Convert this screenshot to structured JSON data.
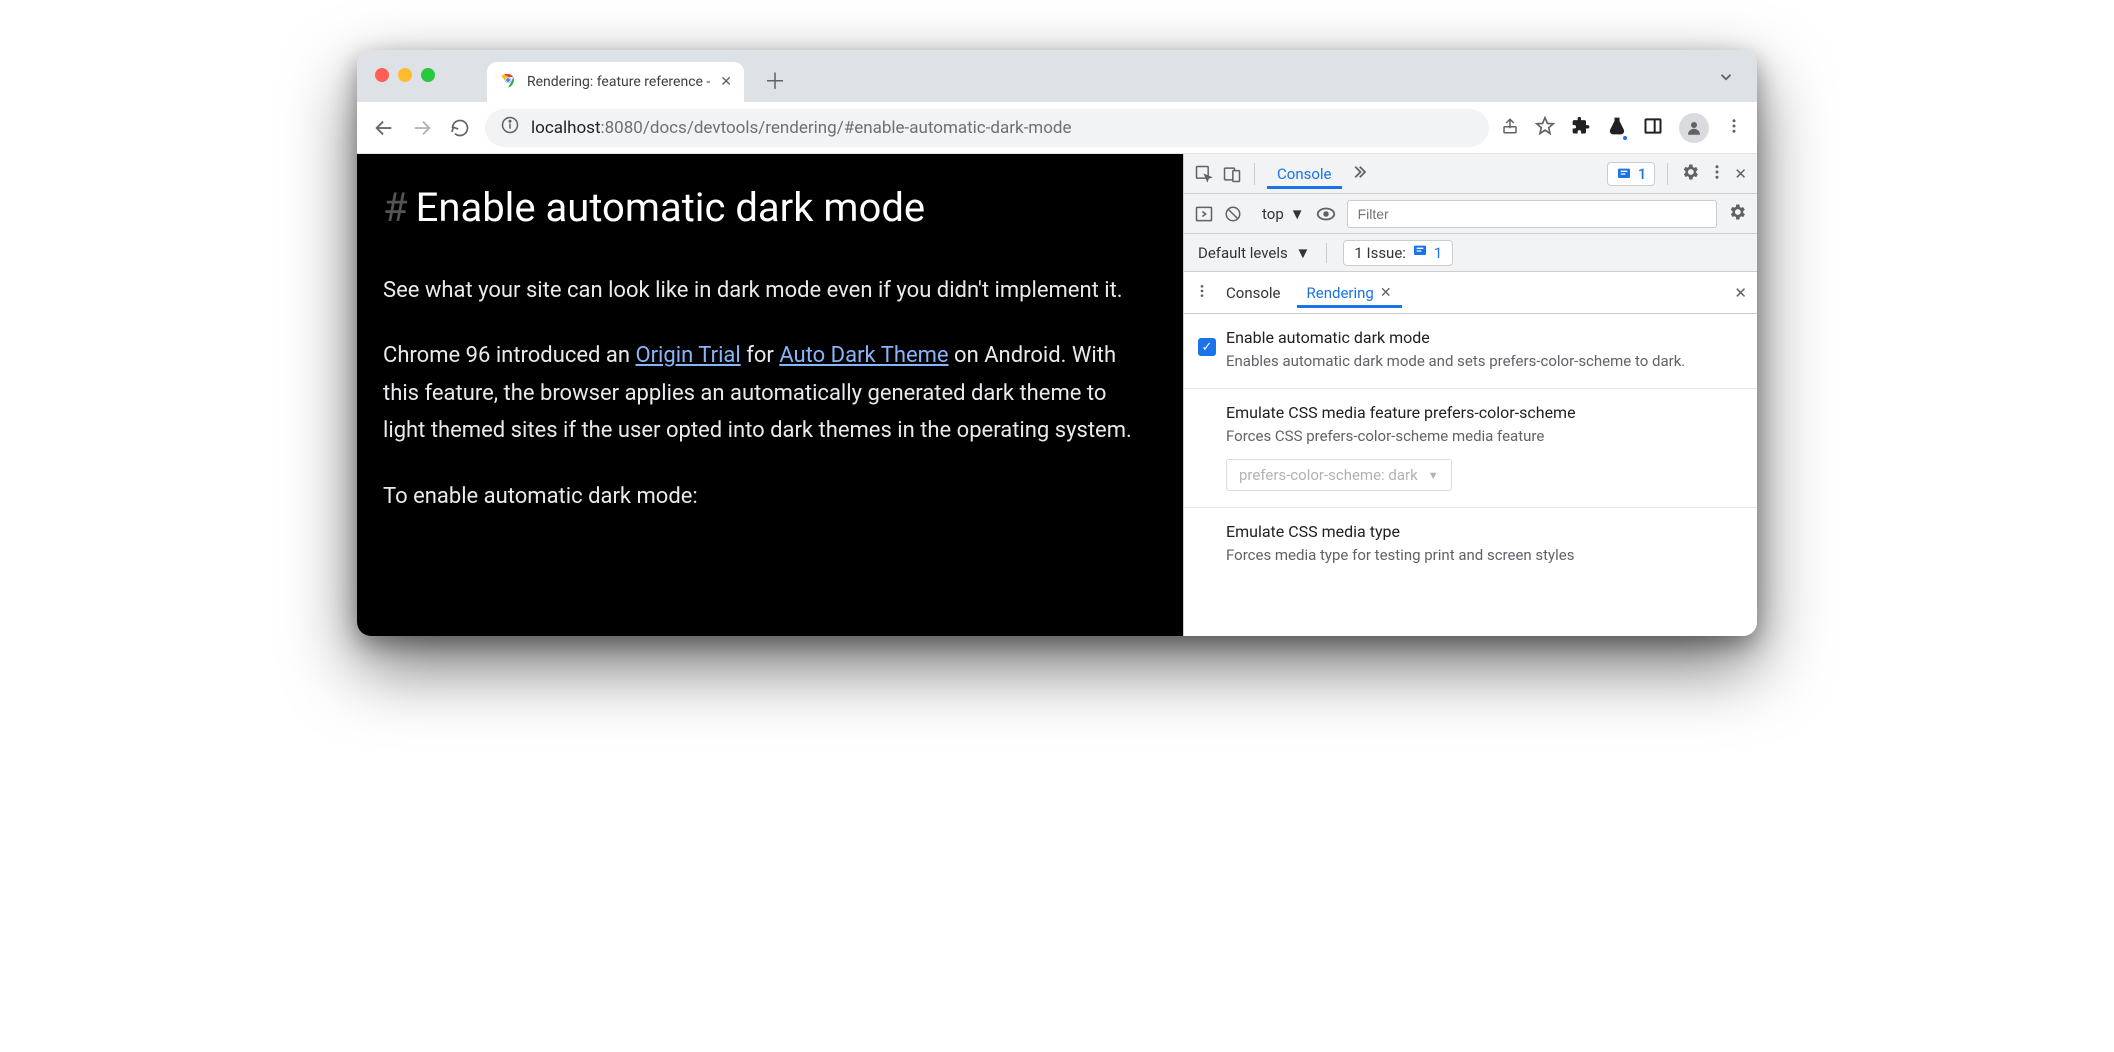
{
  "tab": {
    "title": "Rendering: feature reference -"
  },
  "omnibox": {
    "domain": "localhost",
    "port": ":8080",
    "path": "/docs/devtools/rendering/#enable-automatic-dark-mode"
  },
  "page": {
    "heading": "Enable automatic dark mode",
    "p1": "See what your site can look like in dark mode even if you didn't implement it.",
    "p2_a": "Chrome 96 introduced an ",
    "link1": "Origin Trial",
    "p2_b": " for ",
    "link2": "Auto Dark Theme",
    "p2_c": " on Android. With this feature, the browser applies an automatically generated dark theme to light themed sites if the user opted into dark themes in the operating system.",
    "p3": "To enable automatic dark mode:"
  },
  "devtools": {
    "topTabs": {
      "console": "Console"
    },
    "issuesBadge": "1",
    "consoleToolbar": {
      "context": "top",
      "filterPlaceholder": "Filter"
    },
    "levelsRow": {
      "levels": "Default levels",
      "issuesLabel": "1 Issue:",
      "issuesCount": "1"
    },
    "drawerTabs": {
      "console": "Console",
      "rendering": "Rendering"
    },
    "options": {
      "enableDark": {
        "title": "Enable automatic dark mode",
        "desc": "Enables automatic dark mode and sets prefers-color-scheme to dark."
      },
      "prefersScheme": {
        "title": "Emulate CSS media feature prefers-color-scheme",
        "desc": "Forces CSS prefers-color-scheme media feature",
        "selectValue": "prefers-color-scheme: dark"
      },
      "mediaType": {
        "title": "Emulate CSS media type",
        "desc": "Forces media type for testing print and screen styles"
      }
    }
  }
}
